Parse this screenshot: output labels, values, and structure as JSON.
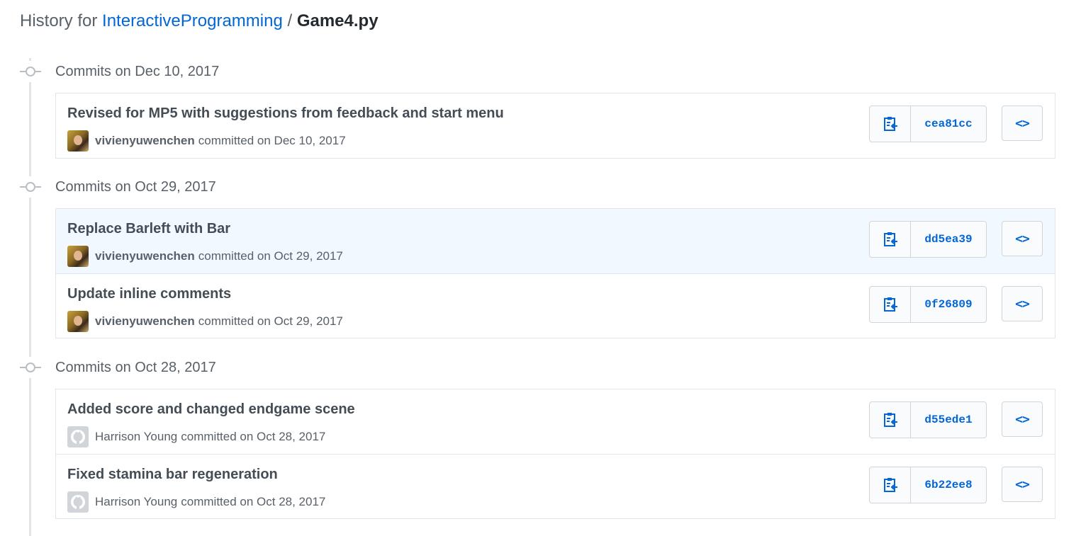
{
  "header": {
    "prefix": "History for",
    "repo": "InteractiveProgramming",
    "separator": "/",
    "file": "Game4.py"
  },
  "colors": {
    "link": "#0366d6",
    "highlight_row": "#f1f8ff",
    "border": "#e1e4e8"
  },
  "groups": [
    {
      "title": "Commits on Dec 10, 2017",
      "commits": [
        {
          "message": "Revised for MP5 with suggestions from feedback and start menu",
          "author": "vivienyuwenchen",
          "meta": "committed on Dec 10, 2017",
          "sha": "cea81cc",
          "avatar": "photo"
        }
      ]
    },
    {
      "title": "Commits on Oct 29, 2017",
      "commits": [
        {
          "message": "Replace Barleft with Bar",
          "author": "vivienyuwenchen",
          "meta": "committed on Oct 29, 2017",
          "sha": "dd5ea39",
          "avatar": "photo",
          "highlighted": true
        },
        {
          "message": "Update inline comments",
          "author": "vivienyuwenchen",
          "meta": "committed on Oct 29, 2017",
          "sha": "0f26809",
          "avatar": "photo"
        }
      ]
    },
    {
      "title": "Commits on Oct 28, 2017",
      "commits": [
        {
          "message": "Added score and changed endgame scene",
          "author": "Harrison Young",
          "meta": "committed on Oct 28, 2017",
          "sha": "d55ede1",
          "avatar": "github-ghost"
        },
        {
          "message": "Fixed stamina bar regeneration",
          "author": "Harrison Young",
          "meta": "committed on Oct 28, 2017",
          "sha": "6b22ee8",
          "avatar": "github-ghost"
        }
      ]
    }
  ],
  "icons": {
    "copy": "clippy-icon",
    "browse": "code-icon",
    "browse_glyph": "<>"
  }
}
